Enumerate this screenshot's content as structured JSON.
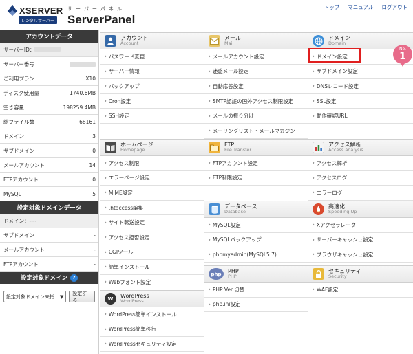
{
  "header": {
    "logo_word": "XSERVER",
    "logo_sub": "レンタルサーバー",
    "product_kana": "サーバーパネル",
    "product_name": "ServerPanel",
    "links": [
      "トップ",
      "マニュアル",
      "ログアウト"
    ]
  },
  "sidebar": {
    "account_title": "アカウントデータ",
    "account_rows": [
      {
        "label": "サーバーID：",
        "value": ""
      },
      {
        "label": "サーバー番号",
        "value": ""
      },
      {
        "label": "ご利用プラン",
        "value": "X10"
      },
      {
        "label": "ディスク使用量",
        "value": "1740.6MB"
      },
      {
        "label": "空き容量",
        "value": "198259.4MB"
      },
      {
        "label": "総ファイル数",
        "value": "68161"
      },
      {
        "label": "ドメイン",
        "value": "3"
      },
      {
        "label": "サブドメイン",
        "value": "0"
      },
      {
        "label": "メールアカウント",
        "value": "14"
      },
      {
        "label": "FTPアカウント",
        "value": "0"
      },
      {
        "label": "MySQL",
        "value": "5"
      }
    ],
    "target_title": "設定対象ドメインデータ",
    "target_rows": [
      {
        "label": "ドメイン：----",
        "value": ""
      },
      {
        "label": "サブドメイン",
        "value": "-"
      },
      {
        "label": "メールアカウント",
        "value": "-"
      },
      {
        "label": "FTPアカウント",
        "value": "-"
      }
    ],
    "select_title": "設定対象ドメイン",
    "select_value": "設定対象ドメイン未指",
    "select_button": "設定する"
  },
  "sections": {
    "account": {
      "ja": "アカウント",
      "en": "Account",
      "items": [
        "パスワード変更",
        "サーバー情報",
        "バックアップ",
        "Cron設定",
        "SSH設定"
      ]
    },
    "homepage": {
      "ja": "ホームページ",
      "en": "Homepage",
      "items": [
        "アクセス制限",
        "エラーページ設定",
        "MIME設定",
        ".htaccess編集",
        "サイト転送設定",
        "アクセス拒否設定",
        "CGIツール",
        "簡単インストール",
        "Webフォント設定"
      ]
    },
    "wordpress": {
      "ja": "WordPress",
      "en": "WordPress",
      "items": [
        "WordPress簡単インストール",
        "WordPress簡単移行",
        "WordPressセキュリティ設定"
      ]
    },
    "mail": {
      "ja": "メール",
      "en": "Mail",
      "items": [
        "メールアカウント設定",
        "迷惑メール設定",
        "自動応答設定",
        "SMTP認証の国外アクセス制限設定",
        "メールの振り分け",
        "メーリングリスト・メールマガジン"
      ]
    },
    "ftp": {
      "ja": "FTP",
      "en": "File Transfer",
      "items": [
        "FTPアカウント設定",
        "FTP制限設定"
      ]
    },
    "database": {
      "ja": "データベース",
      "en": "Database",
      "items": [
        "MySQL設定",
        "MySQLバックアップ",
        "phpmyadmin(MySQL5.7)"
      ]
    },
    "php": {
      "ja": "PHP",
      "en": "PHP",
      "items": [
        "PHP Ver.切替",
        "php.ini設定"
      ]
    },
    "domain": {
      "ja": "ドメイン",
      "en": "Domain",
      "items": [
        "ドメイン設定",
        "サブドメイン設定",
        "DNSレコード設定",
        "SSL設定",
        "動作確認URL"
      ]
    },
    "analysis": {
      "ja": "アクセス解析",
      "en": "Access analysis",
      "items": [
        "アクセス解析",
        "アクセスログ",
        "エラーログ"
      ]
    },
    "speed": {
      "ja": "高速化",
      "en": "Speeding Up",
      "items": [
        "Xアクセラレータ",
        "サーバーキャッシュ設定",
        "ブラウザキャッシュ設定"
      ]
    },
    "security": {
      "ja": "セキュリティ",
      "en": "Security",
      "items": [
        "WAF設定"
      ]
    }
  },
  "badge": {
    "no": "No.",
    "num": "1"
  },
  "colors": {
    "accent_red": "#e01f1f",
    "badge_pink": "#e86b8a",
    "logo_navy": "#1a3d7c"
  }
}
